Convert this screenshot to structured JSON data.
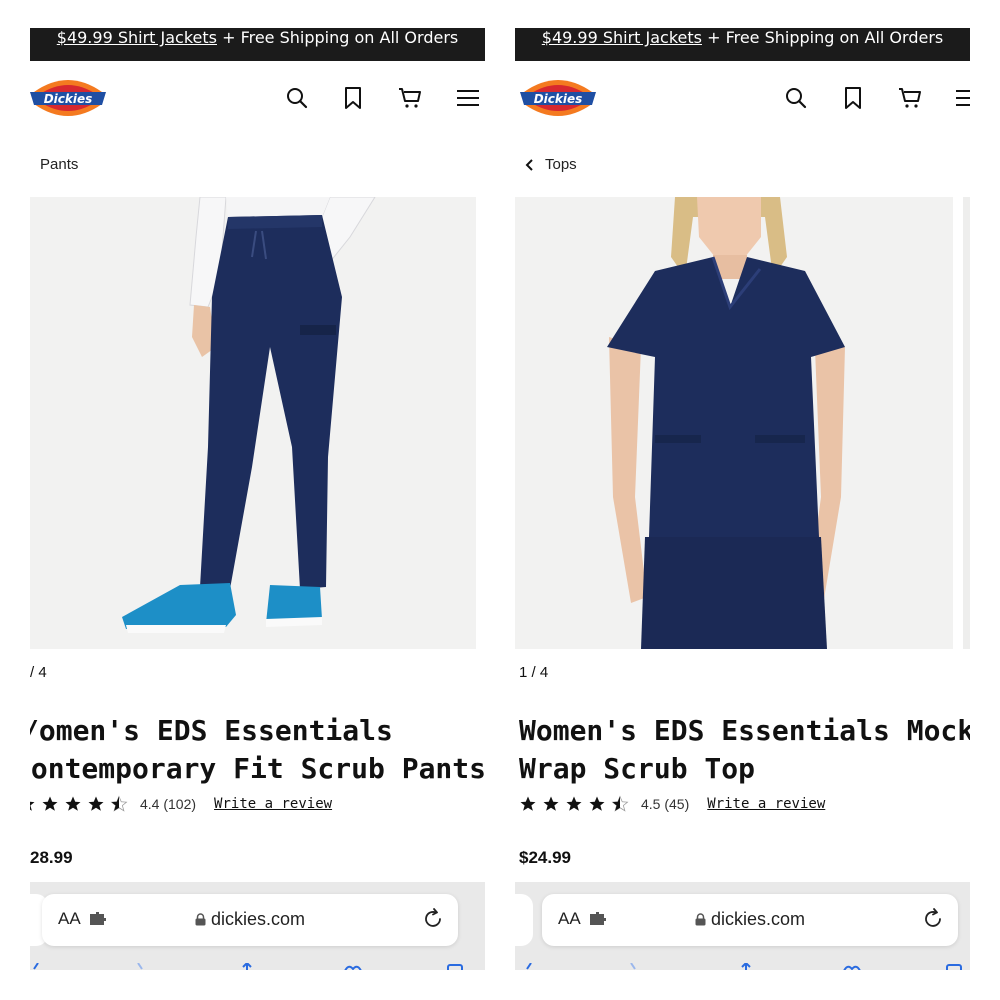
{
  "panels": [
    {
      "promo": {
        "link_text": "$49.99 Shirt Jackets",
        "rest_text": " + Free Shipping on All Orders"
      },
      "breadcrumb": {
        "label": "Pants",
        "has_back": false
      },
      "image": {
        "counter": "/ 4"
      },
      "product": {
        "title_line1": "/omen's EDS Essentials",
        "title_line2": "Contemporary Fit Scrub Pants",
        "rating_value": "4.4",
        "review_count": "(102)",
        "rating_stars": 4.5,
        "review_link": "Write a review",
        "price": "28.99"
      },
      "browser": {
        "aa_label": "AA",
        "url": "dickies.com"
      }
    },
    {
      "promo": {
        "link_text": "$49.99 Shirt Jackets",
        "rest_text": " + Free Shipping on All Orders"
      },
      "breadcrumb": {
        "label": "Tops",
        "has_back": true
      },
      "image": {
        "counter": "1 / 4"
      },
      "product": {
        "title_line1": "Women's EDS Essentials Mock",
        "title_line2": "Wrap Scrub Top",
        "rating_value": "4.5",
        "review_count": "(45)",
        "rating_stars": 4.5,
        "review_link": "Write a review",
        "price": "$24.99"
      },
      "browser": {
        "aa_label": "AA",
        "url": "dickies.com"
      }
    }
  ],
  "colors": {
    "promo_bg": "#1b1b1b",
    "scrub_navy": "#1d2d5c",
    "logo_orange": "#f47a20",
    "logo_blue": "#1f4fa3",
    "logo_red": "#d7282f"
  }
}
